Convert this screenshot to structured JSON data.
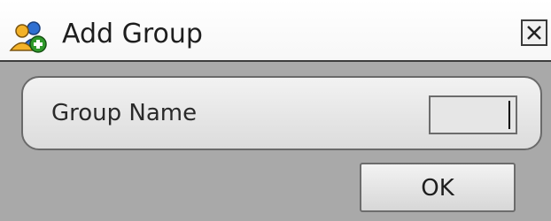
{
  "dialog": {
    "title": "Add Group",
    "title_icon": "add-group-icon",
    "close_icon": "close-icon"
  },
  "form": {
    "group_name_label": "Group Name",
    "group_name_value": ""
  },
  "actions": {
    "ok_label": "OK"
  },
  "colors": {
    "dialog_background": "#a9a9a9",
    "titlebar_background": "#ffffff",
    "panel_background": "#e6e6e6",
    "border": "#6a6a6a"
  }
}
